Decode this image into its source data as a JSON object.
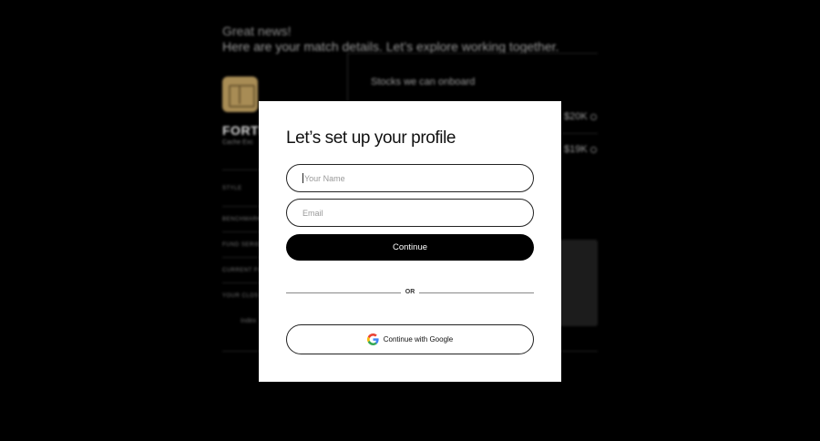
{
  "background": {
    "heading_line1": "Great news!",
    "heading_line2": "Here are your match details. Let’s explore working together.",
    "fund_name": "FORTR",
    "fund_sub": "Cache Exc",
    "labels": [
      "STYLE",
      "BENCHMARK",
      "FUND SERIES",
      "CURRENT FU",
      "YOUR CLOS"
    ],
    "index_text": "Index",
    "stocks_heading": "Stocks we can onboard",
    "prices": [
      "$20K",
      "$19K"
    ]
  },
  "modal": {
    "title": "Let’s set up your profile",
    "name_placeholder": "Your Name",
    "email_placeholder": "Email",
    "continue_label": "Continue",
    "or_label": "OR",
    "google_label": "Continue with Google"
  },
  "colors": {
    "google_blue": "#4285F4",
    "google_red": "#EA4335",
    "google_yellow": "#FBBC05",
    "google_green": "#34A853"
  }
}
